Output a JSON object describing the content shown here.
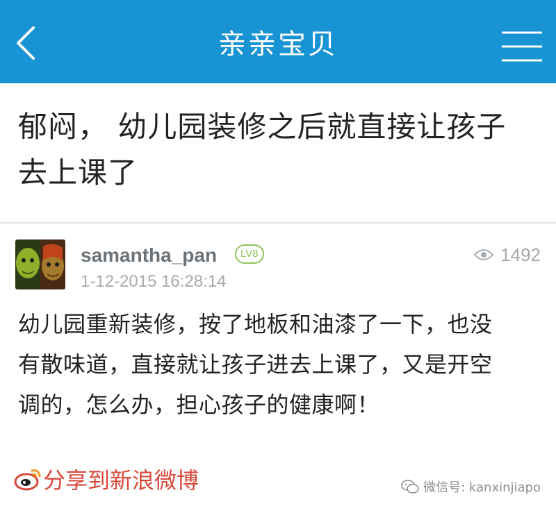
{
  "header": {
    "title": "亲亲宝贝",
    "back_icon": "chevron-left-icon",
    "menu_icon": "hamburger-menu-icon",
    "bg_color": "#1893d3"
  },
  "post": {
    "title_lines": [
      "郁闷， 幼儿园装修之后就直接让孩子",
      "去上课了"
    ],
    "author": "samantha_pan",
    "level": "LV8",
    "date": "1-12-2015 16:28:14",
    "views": "1492",
    "body_lines": [
      "幼儿园重新装修，按了地板和油漆了一下，也没",
      "有散味道，直接就让孩子进去上课了，又是开空",
      "调的，怎么办，担心孩子的健康啊！"
    ]
  },
  "share": {
    "label": "分享到新浪微博",
    "icon": "weibo-icon",
    "color": "#d9483b"
  },
  "watermark": {
    "text": "微信号: kanxinjiapo",
    "icon": "wechat-icon"
  }
}
